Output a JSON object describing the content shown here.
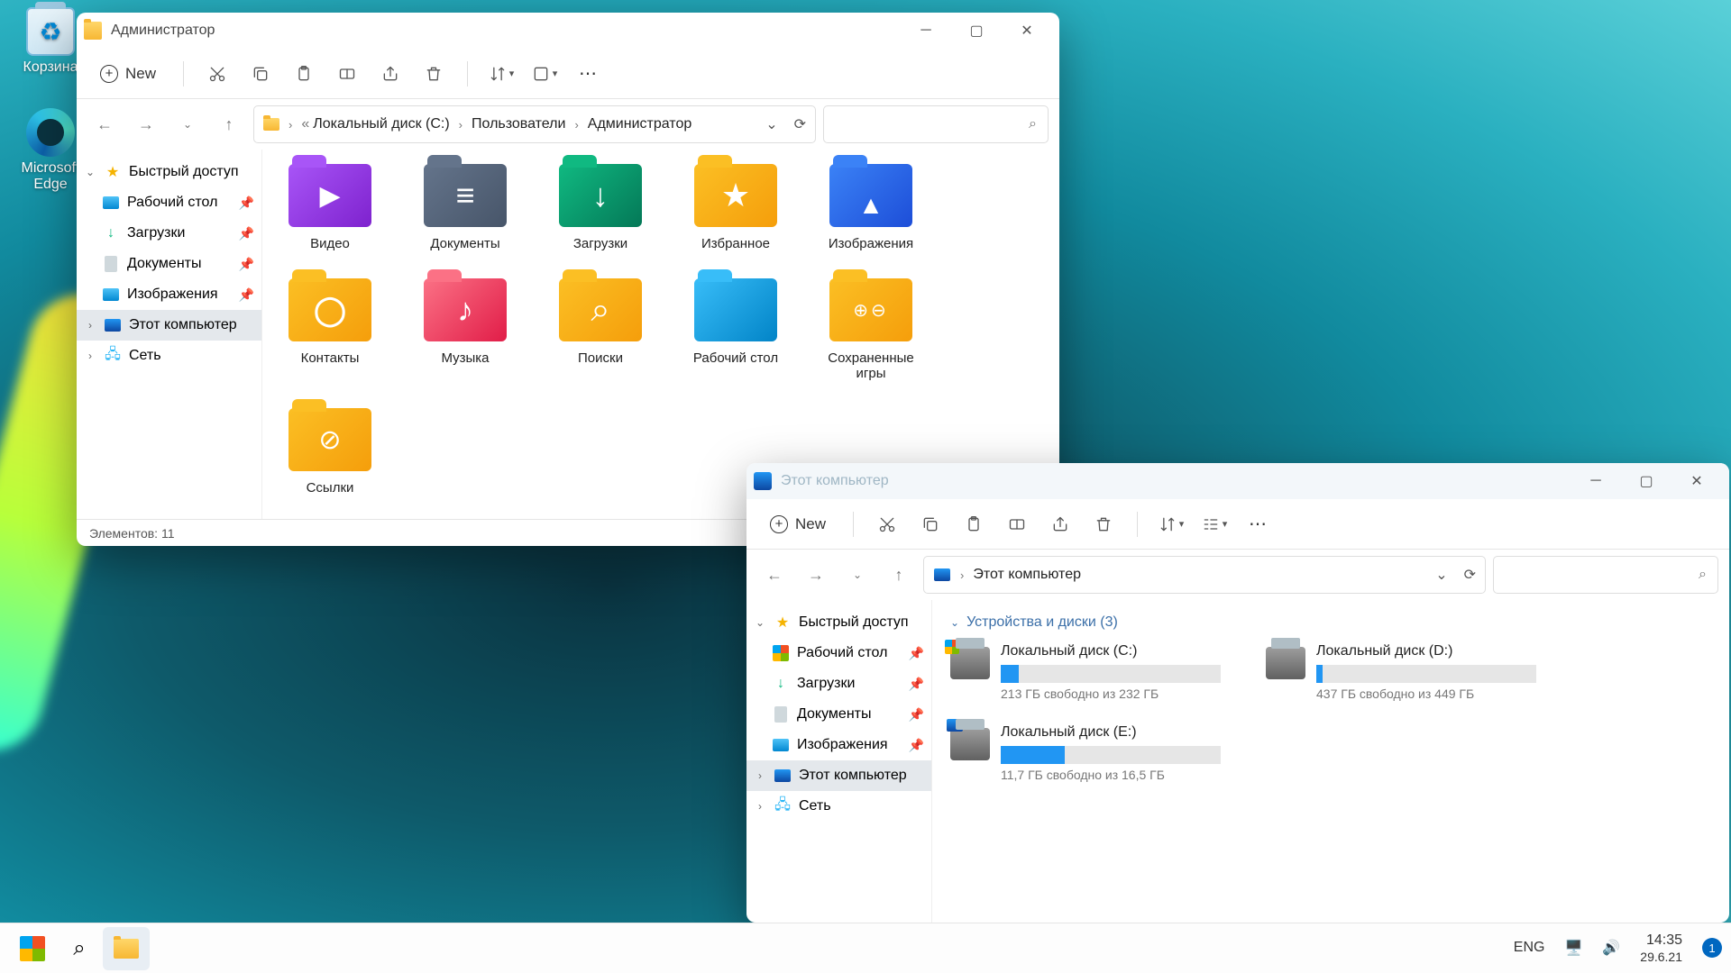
{
  "desktop": {
    "recycle": "Корзина",
    "edge": "Microsoft Edge"
  },
  "win1": {
    "title": "Администратор",
    "new": "New",
    "crumbs": [
      "Локальный диск (C:)",
      "Пользователи",
      "Администратор"
    ],
    "sidebar": {
      "quick": "Быстрый доступ",
      "desktop": "Рабочий стол",
      "downloads": "Загрузки",
      "documents": "Документы",
      "pictures": "Изображения",
      "thispc": "Этот компьютер",
      "network": "Сеть"
    },
    "folders": {
      "video": "Видео",
      "documents": "Документы",
      "downloads": "Загрузки",
      "favorites": "Избранное",
      "pictures": "Изображения",
      "contacts": "Контакты",
      "music": "Музыка",
      "searches": "Поиски",
      "desktop": "Рабочий стол",
      "savedgames": "Сохраненные игры",
      "links": "Ссылки"
    },
    "status": "Элементов: 11"
  },
  "win2": {
    "title": "Этот компьютер",
    "new": "New",
    "crumb": "Этот компьютер",
    "section": "Устройства и диски (3)",
    "sidebar": {
      "quick": "Быстрый доступ",
      "desktop": "Рабочий стол",
      "downloads": "Загрузки",
      "documents": "Документы",
      "pictures": "Изображения",
      "thispc": "Этот компьютер",
      "network": "Сеть"
    },
    "drives": [
      {
        "name": "Локальный диск (C:)",
        "free": "213 ГБ свободно из 232 ГБ",
        "pct": 8,
        "ico": "win"
      },
      {
        "name": "Локальный диск (D:)",
        "free": "437 ГБ свободно из 449 ГБ",
        "pct": 3,
        "ico": ""
      },
      {
        "name": "Локальный диск (E:)",
        "free": "11,7 ГБ свободно из 16,5 ГБ",
        "pct": 29,
        "ico": "pc"
      }
    ]
  },
  "taskbar": {
    "lang": "ENG",
    "time": "14:35",
    "date": "29.6.21",
    "badge": "1"
  }
}
